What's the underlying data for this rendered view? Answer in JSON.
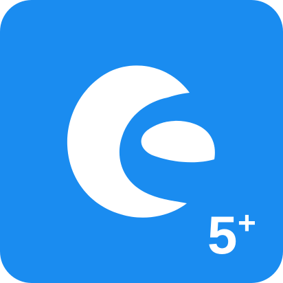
{
  "app_icon": {
    "background_color": "#1A8CF0",
    "mark_color": "#FFFFFF",
    "logo_icon": "shopware-logo-icon",
    "badge": {
      "number": "5",
      "suffix": "+"
    }
  }
}
